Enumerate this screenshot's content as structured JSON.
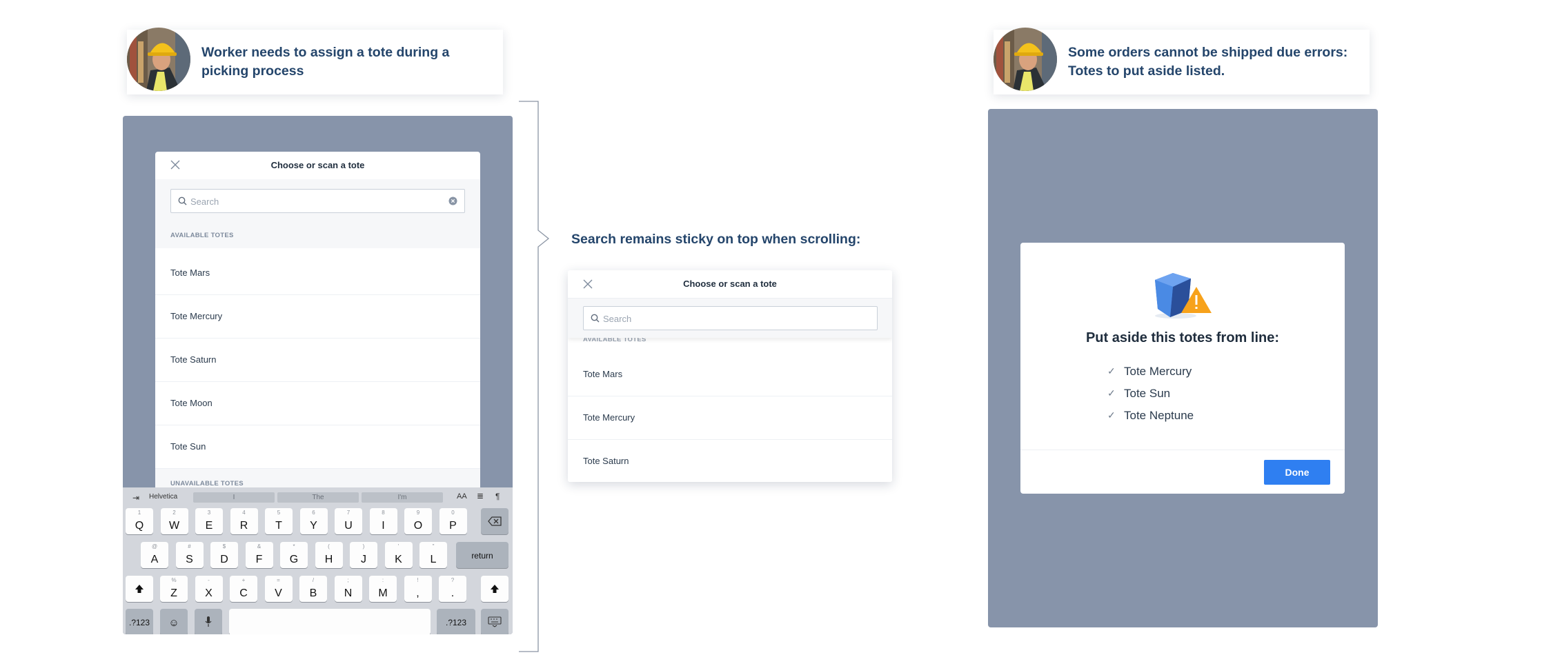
{
  "annotations": {
    "left": "Worker needs to assign a tote during a picking process",
    "left_line1": "Worker needs to assign a tote during a",
    "left_line2": "picking process",
    "right_line1": "Some orders cannot be shipped due errors:",
    "right_line2": "Totes to put aside listed.",
    "middle": "Search remains sticky on top when scrolling:"
  },
  "tote_modal": {
    "title": "Choose or scan a tote",
    "search_placeholder": "Search",
    "available_label": "AVAILABLE TOTES",
    "unavailable_label": "UNAVAILABLE TOTES",
    "items": [
      "Tote Mars",
      "Tote Mercury",
      "Tote Saturn",
      "Tote Moon",
      "Tote Sun"
    ]
  },
  "sticky_modal": {
    "title": "Choose or scan a tote",
    "search_placeholder": "Search",
    "available_label": "AVAILABLE TOTES",
    "items": [
      "Tote Mars",
      "Tote Mercury",
      "Tote Saturn"
    ]
  },
  "keyboard": {
    "tab_label": "Helvetica",
    "suggestions": [
      "I",
      "The",
      "I'm"
    ],
    "font_size_label": "AA",
    "row1": [
      [
        "1",
        "Q"
      ],
      [
        "2",
        "W"
      ],
      [
        "3",
        "E"
      ],
      [
        "4",
        "R"
      ],
      [
        "5",
        "T"
      ],
      [
        "6",
        "Y"
      ],
      [
        "7",
        "U"
      ],
      [
        "8",
        "I"
      ],
      [
        "9",
        "O"
      ],
      [
        "0",
        "P"
      ]
    ],
    "row2": [
      [
        "@",
        "A"
      ],
      [
        "#",
        "S"
      ],
      [
        "$",
        "D"
      ],
      [
        "&",
        "F"
      ],
      [
        "*",
        "G"
      ],
      [
        "(",
        "H"
      ],
      [
        ")",
        "J"
      ],
      [
        "'",
        "K"
      ],
      [
        "\"",
        "L"
      ]
    ],
    "row3": [
      [
        "%",
        "Z"
      ],
      [
        "-",
        "X"
      ],
      [
        "+",
        "C"
      ],
      [
        "=",
        "V"
      ],
      [
        "/",
        "B"
      ],
      [
        ";",
        "N"
      ],
      [
        ":",
        "M"
      ],
      [
        "!",
        ","
      ],
      [
        "?",
        "."
      ]
    ],
    "return_label": "return",
    "numbers_label": ".?123"
  },
  "put_aside_dialog": {
    "title": "Put aside this totes from line:",
    "items": [
      "Tote Mercury",
      "Tote Sun",
      "Tote Neptune"
    ],
    "done_label": "Done"
  },
  "colors": {
    "overlay": "#8794aa",
    "accent": "#2f7ff1",
    "heading": "#24456b",
    "warning": "#f7a21b"
  }
}
